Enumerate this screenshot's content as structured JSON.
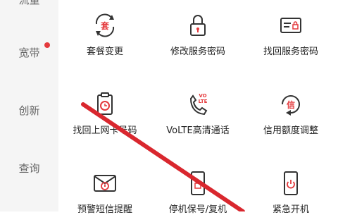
{
  "sidebar": {
    "items": [
      {
        "label": "流量",
        "badge": false
      },
      {
        "label": "宽带",
        "badge": true
      },
      {
        "label": "创新",
        "badge": false
      },
      {
        "label": "查询",
        "badge": false
      }
    ]
  },
  "services": [
    {
      "label": "套餐变更",
      "icon": "plan-change-icon"
    },
    {
      "label": "修改服务密码",
      "icon": "lock-icon"
    },
    {
      "label": "找回服务密码",
      "icon": "password-card-icon"
    },
    {
      "label": "找回上网卡号码",
      "icon": "clipboard-clock-icon"
    },
    {
      "label": "VoLTE高清通话",
      "icon": "volte-phone-icon"
    },
    {
      "label": "信用额度调整",
      "icon": "credit-adjust-icon"
    },
    {
      "label": "预警短信提醒",
      "icon": "alert-sms-icon"
    },
    {
      "label": "停机保号/复机",
      "icon": "phone-lock-icon"
    },
    {
      "label": "紧急开机",
      "icon": "phone-power-icon"
    }
  ],
  "icon_text": {
    "plan": "套",
    "credit": "信",
    "volte_top": "VO",
    "volte_bottom": "LTE"
  },
  "colors": {
    "accent": "#e4393c",
    "icon_stroke": "#333333",
    "sidebar_bg": "#f5f5f5",
    "slash": "#d9272e"
  }
}
